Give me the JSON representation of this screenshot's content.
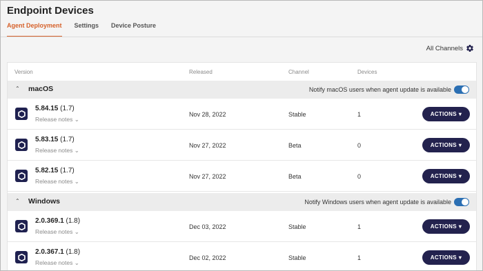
{
  "page": {
    "title": "Endpoint Devices"
  },
  "tabs": [
    {
      "label": "Agent Deployment",
      "active": true
    },
    {
      "label": "Settings",
      "active": false
    },
    {
      "label": "Device Posture",
      "active": false
    }
  ],
  "all_channels_label": "All Channels",
  "columns": {
    "version": "Version",
    "released": "Released",
    "channel": "Channel",
    "devices": "Devices"
  },
  "groups": [
    {
      "name": "macOS",
      "notify_label": "Notify macOS users when agent update is available",
      "notify_enabled": true,
      "rows": [
        {
          "version": "5.84.15",
          "build": "(1.7)",
          "notes": "Release notes",
          "released": "Nov 28, 2022",
          "channel": "Stable",
          "devices": "1",
          "action": "ACTIONS"
        },
        {
          "version": "5.83.15",
          "build": "(1.7)",
          "notes": "Release notes",
          "released": "Nov 27, 2022",
          "channel": "Beta",
          "devices": "0",
          "action": "ACTIONS"
        },
        {
          "version": "5.82.15",
          "build": "(1.7)",
          "notes": "Release notes",
          "released": "Nov 27, 2022",
          "channel": "Beta",
          "devices": "0",
          "action": "ACTIONS"
        }
      ]
    },
    {
      "name": "Windows",
      "notify_label": "Notify Windows users when agent update is available",
      "notify_enabled": true,
      "rows": [
        {
          "version": "2.0.369.1",
          "build": "(1.8)",
          "notes": "Release notes",
          "released": "Dec 03, 2022",
          "channel": "Stable",
          "devices": "1",
          "action": "ACTIONS"
        },
        {
          "version": "2.0.367.1",
          "build": "(1.8)",
          "notes": "Release notes",
          "released": "Dec 02, 2022",
          "channel": "Stable",
          "devices": "1",
          "action": "ACTIONS"
        }
      ]
    }
  ],
  "colors": {
    "accent": "#d6612a",
    "button": "#23224e",
    "toggle": "#2b6fb3"
  }
}
